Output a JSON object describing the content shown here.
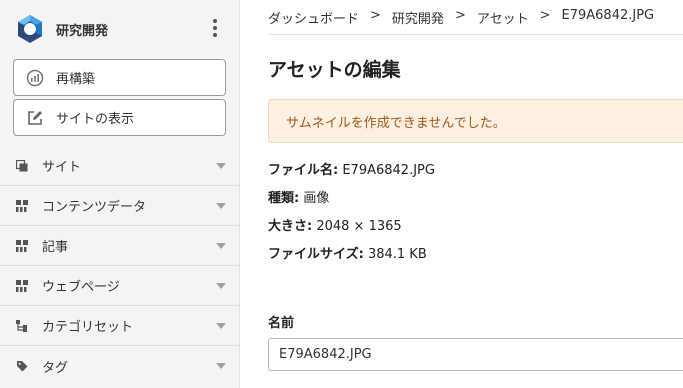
{
  "site": {
    "name": "研究開発"
  },
  "sidebar": {
    "actions": [
      {
        "label": "再構築",
        "icon": "rebuild-gauge-icon"
      },
      {
        "label": "サイトの表示",
        "icon": "edit-square-icon"
      }
    ],
    "items": [
      {
        "label": "サイト",
        "icon": "sites-icon"
      },
      {
        "label": "コンテンツデータ",
        "icon": "content-data-icon"
      },
      {
        "label": "記事",
        "icon": "entries-icon"
      },
      {
        "label": "ウェブページ",
        "icon": "webpages-icon"
      },
      {
        "label": "カテゴリセット",
        "icon": "category-set-icon"
      },
      {
        "label": "タグ",
        "icon": "tag-icon"
      }
    ]
  },
  "breadcrumb": {
    "items": [
      "ダッシュボード",
      "研究開発",
      "アセット",
      "E79A6842.JPG"
    ],
    "separator": ">"
  },
  "page": {
    "title": "アセットの編集"
  },
  "alert": {
    "message": "サムネイルを作成できませんでした。"
  },
  "asset_info": {
    "filename": {
      "label": "ファイル名:",
      "value": "E79A6842.JPG"
    },
    "type": {
      "label": "種類:",
      "value": "画像"
    },
    "dimensions": {
      "label": "大きさ:",
      "value": "2048 × 1365"
    },
    "filesize": {
      "label": "ファイルサイズ:",
      "value": "384.1 KB"
    }
  },
  "form": {
    "name_label": "名前",
    "name_value": "E79A6842.JPG"
  },
  "colors": {
    "sidebar_bg": "#f4f4f4",
    "alert_bg": "#fdf0e1",
    "alert_text": "#9a5a1d",
    "logo_blue": "#1f78c8",
    "logo_dark": "#2b4a7a"
  }
}
